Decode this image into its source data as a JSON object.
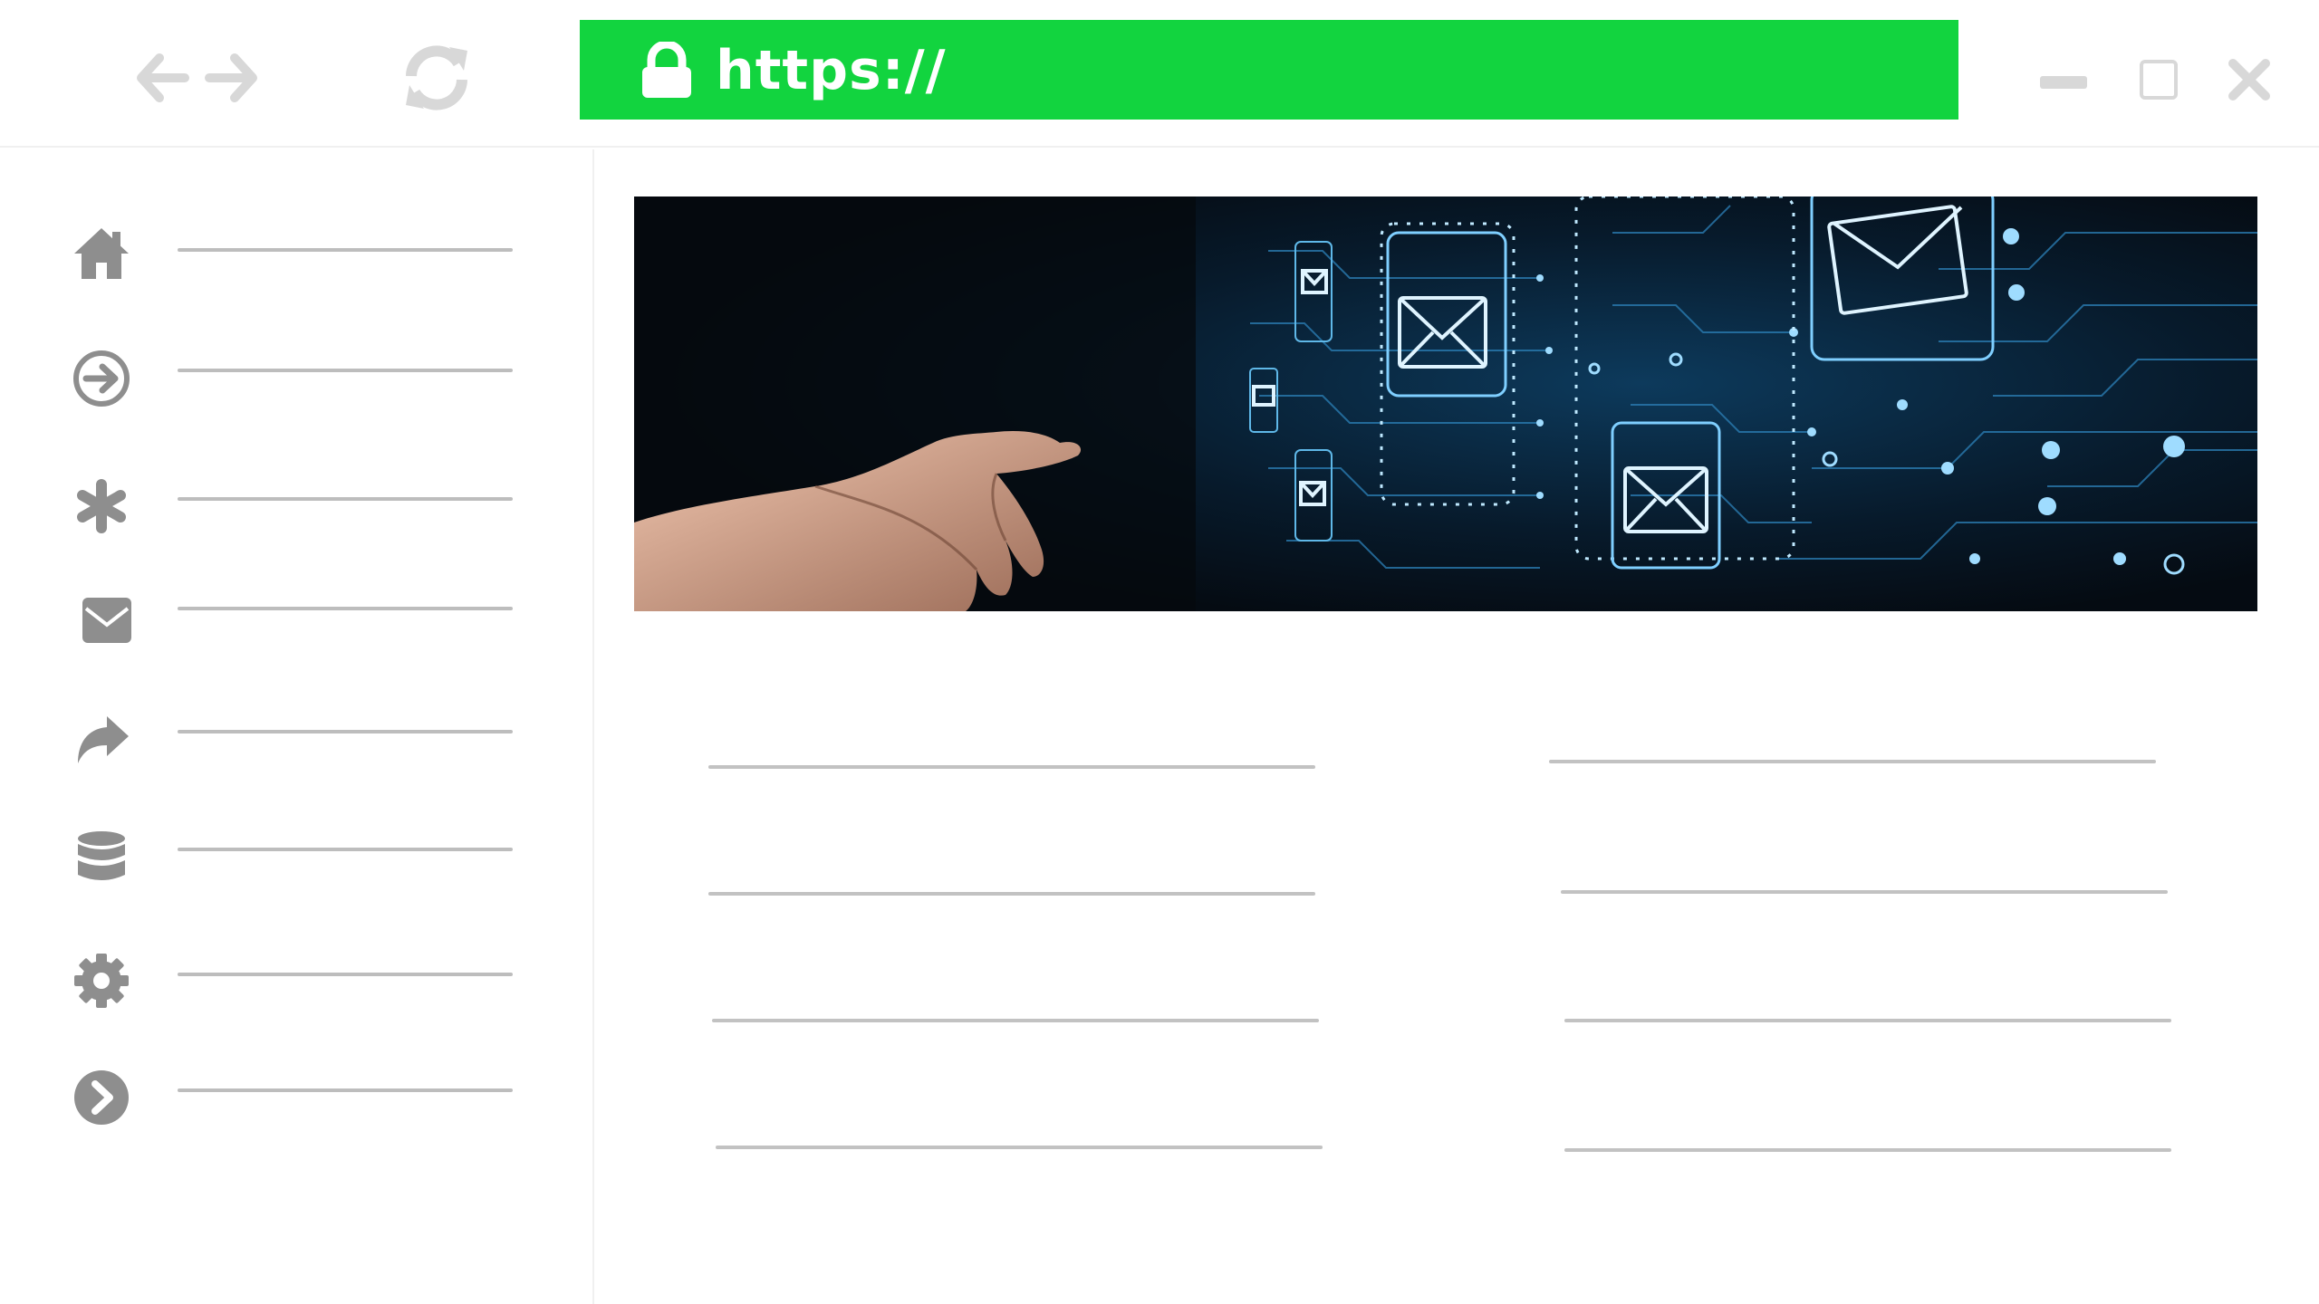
{
  "toolbar": {
    "back_icon": "arrow-left-icon",
    "forward_icon": "arrow-right-icon",
    "reload_icon": "refresh-icon"
  },
  "address_bar": {
    "url_text": "https://",
    "lock_icon": "lock-icon",
    "bg_color": "#12d43f",
    "text_color": "#ffffff"
  },
  "window_controls": {
    "minimize_icon": "minimize-icon",
    "maximize_icon": "maximize-icon",
    "close_icon": "close-icon"
  },
  "sidebar": {
    "items": [
      {
        "icon": "home-icon"
      },
      {
        "icon": "sign-in-icon"
      },
      {
        "icon": "asterisk-icon"
      },
      {
        "icon": "envelope-icon"
      },
      {
        "icon": "share-icon"
      },
      {
        "icon": "database-icon"
      },
      {
        "icon": "gear-icon"
      },
      {
        "icon": "chevron-right-circle-icon"
      }
    ]
  },
  "hero": {
    "image": "hand-touching-email-circuit-board"
  },
  "colors": {
    "icon_gray": "#8e8e8e",
    "line_gray": "#c2c2c2",
    "light_gray": "#d8d8d8"
  }
}
